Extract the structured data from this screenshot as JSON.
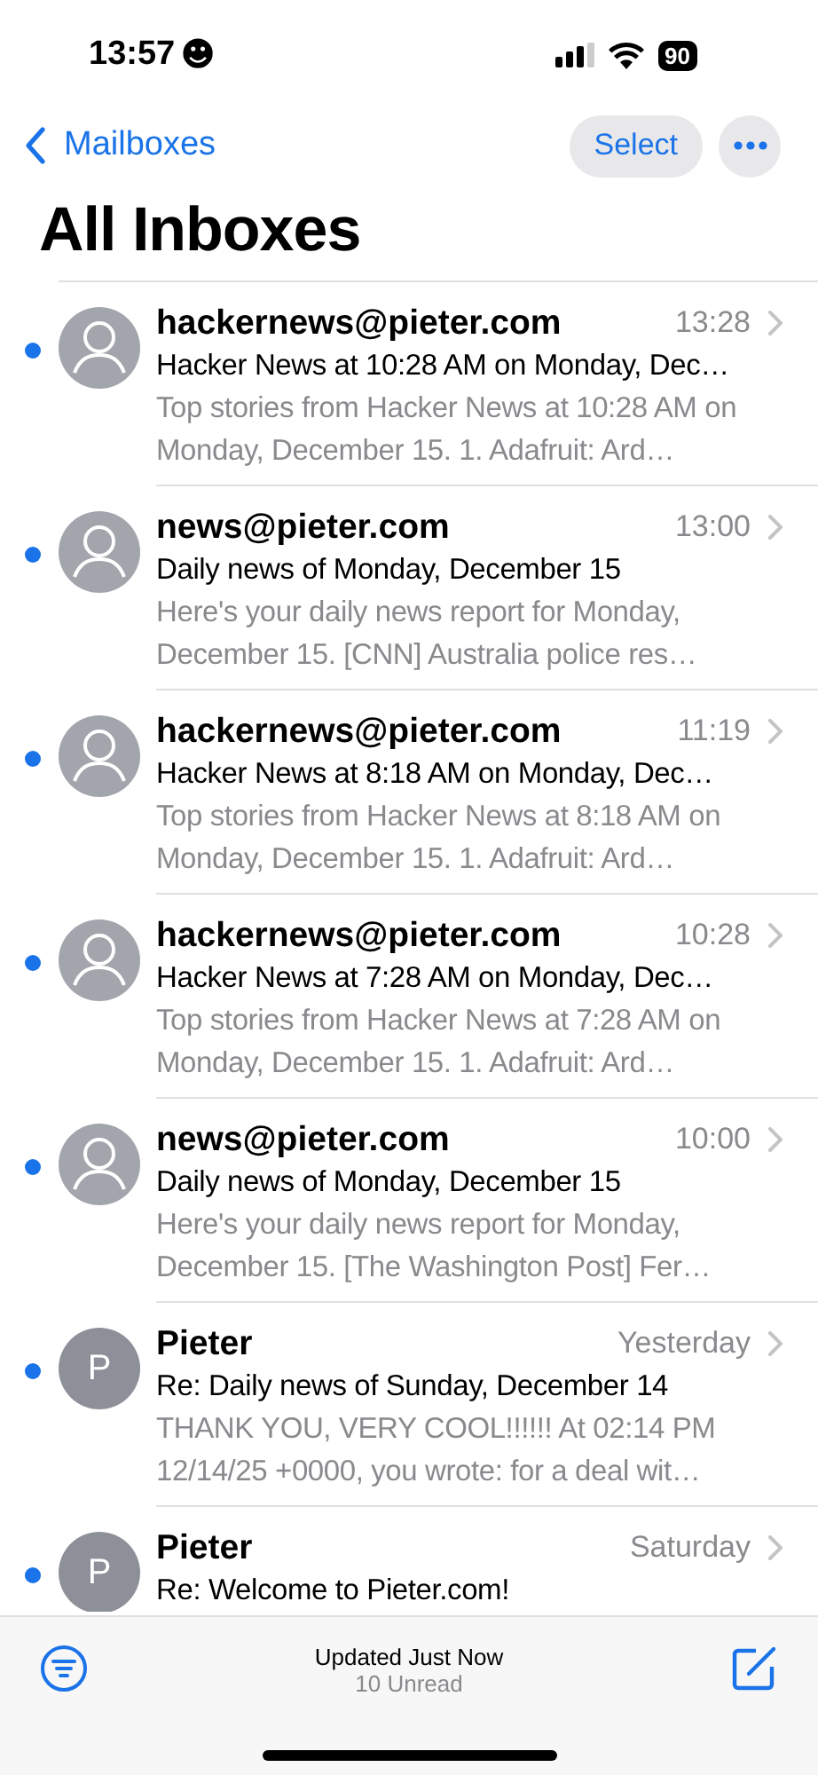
{
  "status_bar": {
    "time": "13:57",
    "emoji": "☻",
    "battery": "90"
  },
  "nav": {
    "back": "Mailboxes",
    "select": "Select"
  },
  "title": "All Inboxes",
  "messages": [
    {
      "sender": "hackernews@pieter.com",
      "time": "13:28",
      "subject": "Hacker News at 10:28 AM on Monday, Dec…",
      "preview": "Top stories from Hacker News at 10:28 AM on Monday, December 15. 1. Adafruit: Ard…",
      "unread": true,
      "avatar": {
        "kind": "silhouette"
      }
    },
    {
      "sender": "news@pieter.com",
      "time": "13:00",
      "subject": "Daily news of Monday, December 15",
      "preview": "Here's your daily news report for Monday, December 15. [CNN] Australia police res…",
      "unread": true,
      "avatar": {
        "kind": "silhouette"
      }
    },
    {
      "sender": "hackernews@pieter.com",
      "time": "11:19",
      "subject": "Hacker News at 8:18 AM on Monday, Dec…",
      "preview": "Top stories from Hacker News at 8:18 AM on Monday, December 15. 1. Adafruit: Ard…",
      "unread": true,
      "avatar": {
        "kind": "silhouette"
      }
    },
    {
      "sender": "hackernews@pieter.com",
      "time": "10:28",
      "subject": "Hacker News at 7:28 AM on Monday, Dec…",
      "preview": "Top stories from Hacker News at 7:28 AM on Monday, December 15. 1. Adafruit: Ard…",
      "unread": true,
      "avatar": {
        "kind": "silhouette"
      }
    },
    {
      "sender": "news@pieter.com",
      "time": "10:00",
      "subject": "Daily news of Monday, December 15",
      "preview": "Here's your daily news report for Monday, December 15. [The Washington Post] Fer…",
      "unread": true,
      "avatar": {
        "kind": "silhouette"
      }
    },
    {
      "sender": "Pieter",
      "time": "Yesterday",
      "subject": "Re: Daily news of Sunday, December 14",
      "preview": "THANK YOU, VERY COOL!!!!!! At 02:14 PM 12/14/25 +0000, you wrote: for a deal wit…",
      "unread": true,
      "avatar": {
        "kind": "initial",
        "letter": "P"
      }
    },
    {
      "sender": "Pieter",
      "time": "Saturday",
      "subject": "Re: Welcome to Pieter.com!",
      "unread": true,
      "avatar": {
        "kind": "initial",
        "letter": "P"
      }
    }
  ],
  "toolbar": {
    "status": "Updated Just Now",
    "unread": "10 Unread"
  }
}
